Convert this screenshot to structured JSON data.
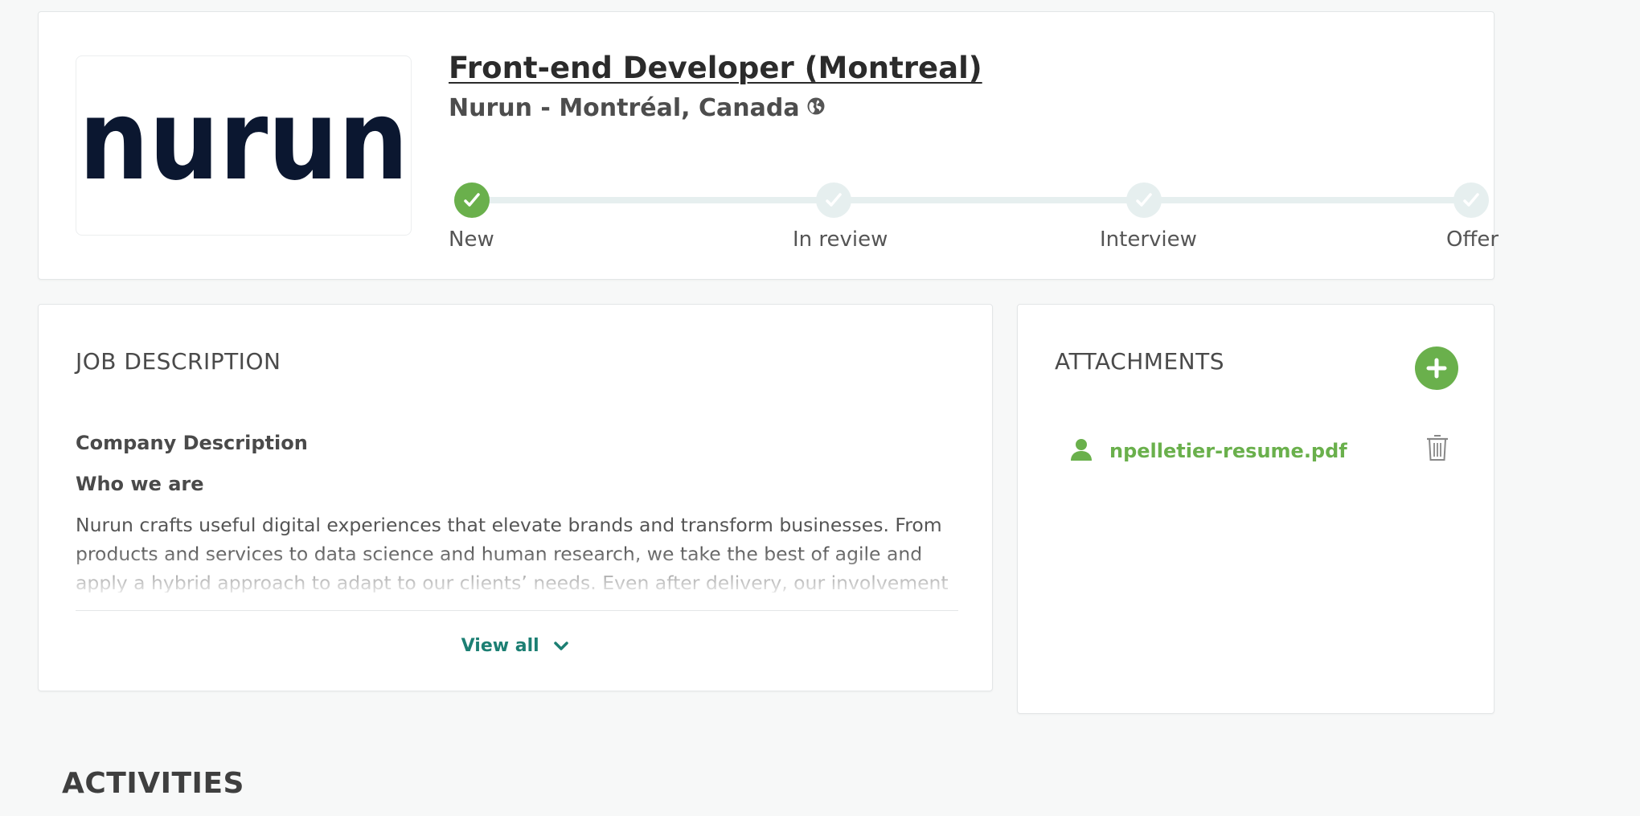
{
  "job": {
    "title": "Front-end Developer (Montreal)",
    "company_location": "Nurun - Montréal, Canada",
    "logo_text": "nurun"
  },
  "pipeline": {
    "steps": [
      {
        "label": "New",
        "status": "done"
      },
      {
        "label": "In review",
        "status": "pending"
      },
      {
        "label": "Interview",
        "status": "pending"
      },
      {
        "label": "Offer",
        "status": "pending"
      }
    ]
  },
  "description": {
    "heading": "JOB DESCRIPTION",
    "sub1": "Company Description",
    "sub2": "Who we are",
    "body": "Nurun crafts useful digital experiences that elevate brands and transform businesses. From products and services to data science and human research, we take the best of agile and apply a hybrid approach to adapt to our clients’ needs. Even after delivery, our involvement doesn’t end.",
    "view_all": "View all"
  },
  "attachments": {
    "heading": "ATTACHMENTS",
    "files": [
      {
        "name": "npelletier-resume.pdf",
        "icon": "user-icon"
      }
    ]
  },
  "activities": {
    "heading": "ACTIVITIES"
  },
  "colors": {
    "accent_green": "#6ab04c",
    "link_teal": "#1c7f73",
    "logo_navy": "#0b1730",
    "step_pending": "#e6efef"
  }
}
